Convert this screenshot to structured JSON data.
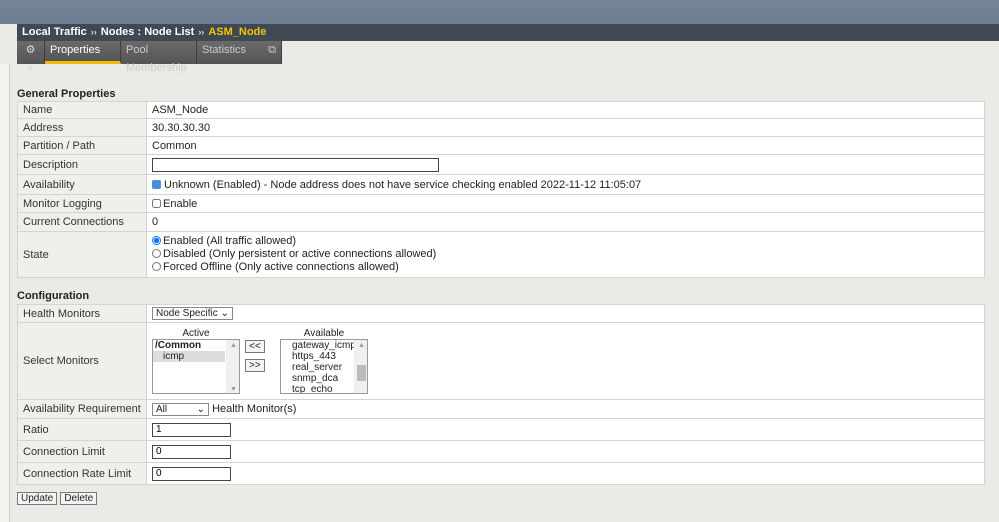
{
  "breadcrumb": {
    "items": [
      "Local Traffic",
      "Nodes : Node List"
    ],
    "current": "ASM_Node",
    "separator": "››"
  },
  "tabs": [
    {
      "label": "Properties"
    },
    {
      "label": "Pool Membership"
    },
    {
      "label": "Statistics"
    }
  ],
  "general": {
    "title": "General Properties",
    "name_label": "Name",
    "name": "ASM_Node",
    "address_label": "Address",
    "address": "30.30.30.30",
    "partition_label": "Partition / Path",
    "partition": "Common",
    "description_label": "Description",
    "description": "",
    "availability_label": "Availability",
    "availability": "Unknown (Enabled) - Node address does not have service checking enabled 2022-11-12 11:05:07",
    "monitor_logging_label": "Monitor Logging",
    "monitor_logging": "Enable",
    "connections_label": "Current Connections",
    "connections": "0",
    "state_label": "State",
    "state_options": [
      "Enabled (All traffic allowed)",
      "Disabled (Only persistent or active connections allowed)",
      "Forced Offline (Only active connections allowed)"
    ]
  },
  "config": {
    "title": "Configuration",
    "health_label": "Health Monitors",
    "health": "Node Specific",
    "select_label": "Select Monitors",
    "active_label": "Active",
    "available_label": "Available",
    "active_group": "/Common",
    "active": [
      "icmp"
    ],
    "available": [
      "gateway_icmp",
      "https_443",
      "real_server",
      "snmp_dca",
      "tcp_echo"
    ],
    "move_left": "<<",
    "move_right": ">>",
    "req_label": "Availability Requirement",
    "req": "All",
    "req_suffix": "Health Monitor(s)",
    "ratio_label": "Ratio",
    "ratio": "1",
    "limit_label": "Connection Limit",
    "limit": "0",
    "rate_label": "Connection Rate Limit",
    "rate": "0"
  },
  "buttons": {
    "update": "Update",
    "delete": "Delete"
  }
}
